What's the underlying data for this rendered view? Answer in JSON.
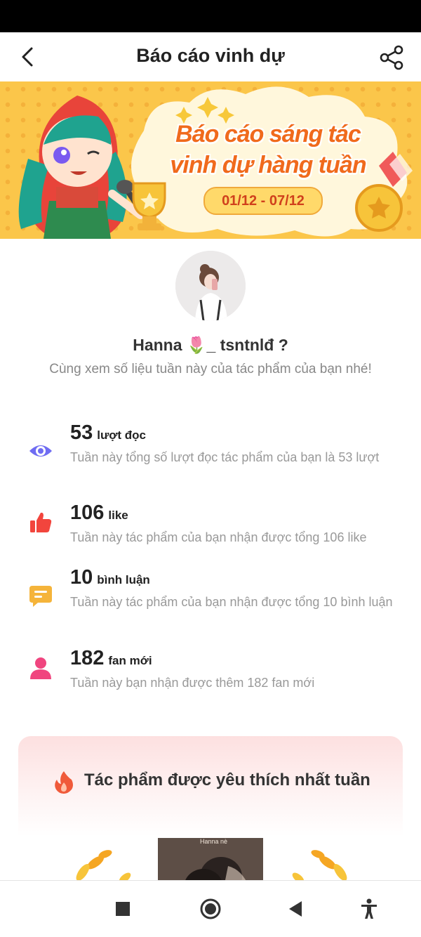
{
  "header": {
    "title": "Báo cáo vinh dự"
  },
  "banner": {
    "title_line1": "Báo cáo sáng tác",
    "title_line2": "vinh dự hàng tuần",
    "date_range": "01/12 - 07/12"
  },
  "profile": {
    "username": "Hanna 🌷_ tsntnlđ ?",
    "subtitle": "Cùng xem số liệu tuần này của tác phẩm của bạn nhé!"
  },
  "stats": [
    {
      "icon": "eye-icon",
      "color": "#6f6cf2",
      "value": "53",
      "unit": "lượt đọc",
      "desc": "Tuần này tổng số lượt đọc tác phẩm của bạn là 53 lượt"
    },
    {
      "icon": "thumbs-up-icon",
      "color": "#f2453d",
      "value": "106",
      "unit": "like",
      "desc": "Tuần này tác phẩm của bạn nhận được tổng 106 like"
    },
    {
      "icon": "comment-icon",
      "color": "#f5b43a",
      "value": "10",
      "unit": "bình luận",
      "desc": "Tuần này tác phẩm của bạn nhận được tổng 10 bình luận"
    },
    {
      "icon": "user-icon",
      "color": "#f0457f",
      "value": "182",
      "unit": "fan mới",
      "desc": "Tuần này bạn nhận được thêm 182 fan mới"
    }
  ],
  "favorite": {
    "title": "Tác phẩm được yêu thích nhất tuần",
    "cover_label": "Hanna nè"
  },
  "colors": {
    "banner_bg": "#fbc64a",
    "accent_orange": "#f06a1c",
    "text_muted": "#999999"
  }
}
